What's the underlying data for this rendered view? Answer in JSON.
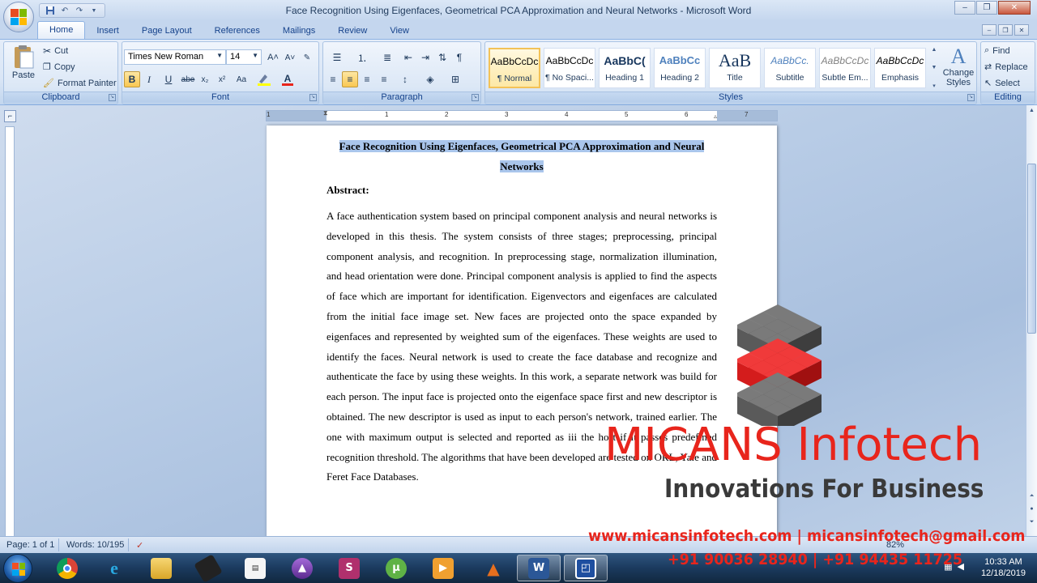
{
  "window": {
    "title": "Face Recognition Using Eigenfaces, Geometrical PCA Approximation and Neural Networks - Microsoft Word",
    "minimize": "‒",
    "restore": "❐",
    "close": "✕"
  },
  "tabs": [
    {
      "label": "Home",
      "active": true
    },
    {
      "label": "Insert"
    },
    {
      "label": "Page Layout"
    },
    {
      "label": "References"
    },
    {
      "label": "Mailings"
    },
    {
      "label": "Review"
    },
    {
      "label": "View"
    }
  ],
  "clipboard": {
    "paste": "Paste",
    "cut": "Cut",
    "copy": "Copy",
    "format_painter": "Format Painter",
    "label": "Clipboard"
  },
  "font": {
    "name": "Times New Roman",
    "size": "14",
    "label": "Font",
    "grow": "A˄",
    "shrink": "A˅",
    "bold": "B",
    "italic": "I",
    "underline": "U",
    "strike": "abe",
    "subscript": "x₂",
    "superscript": "x²",
    "change_case": "Aa",
    "font_color": "A"
  },
  "paragraph": {
    "label": "Paragraph",
    "pilcrow": "¶"
  },
  "styles": {
    "label": "Styles",
    "items": [
      {
        "sample": "AaBbCcDc",
        "name": "¶ Normal",
        "selected": true
      },
      {
        "sample": "AaBbCcDc",
        "name": "¶ No Spaci..."
      },
      {
        "sample": "AaBbC(",
        "name": "Heading 1"
      },
      {
        "sample": "AaBbCc",
        "name": "Heading 2"
      },
      {
        "sample": "AaB",
        "name": "Title"
      },
      {
        "sample": "AaBbCc.",
        "name": "Subtitle"
      },
      {
        "sample": "AaBbCcDc",
        "name": "Subtle Em..."
      },
      {
        "sample": "AaBbCcDc",
        "name": "Emphasis"
      }
    ],
    "change_styles": "Change Styles"
  },
  "editing": {
    "label": "Editing",
    "find": "Find",
    "replace": "Replace",
    "select": "Select"
  },
  "ruler": {
    "numbers": [
      "1",
      "1",
      "2",
      "3",
      "4",
      "5",
      "6",
      "7"
    ]
  },
  "document": {
    "title": "Face Recognition Using Eigenfaces, Geometrical PCA Approximation and Neural Networks",
    "abstract_heading": "Abstract:",
    "abstract_body": "A face authentication system based on principal component analysis and neural networks is developed in this thesis. The system consists of three stages; preprocessing, principal component analysis, and recognition. In preprocessing stage, normalization illumination, and head orientation were done. Principal component analysis is applied to find the aspects of face which are important for identification. Eigenvectors and eigenfaces are calculated from the initial face image set. New faces are projected onto the space expanded by eigenfaces and represented by weighted sum of the eigenfaces. These weights are used to identify the faces. Neural network is used to create the face database and recognize and authenticate the face by using these weights. In this work, a separate network was build for each person. The input face is projected onto the eigenface space first and new descriptor is obtained. The new descriptor is used as input to each person's network, trained earlier. The one with maximum output is selected and reported as iii the host if it passes predefined recognition threshold. The algorithms that have been developed are tested on ORL, Yale and Feret Face Databases."
  },
  "status": {
    "page": "Page: 1 of 1",
    "words": "Words: 10/195",
    "zoom": "82%"
  },
  "taskbar": {
    "time": "10:33 AM",
    "date": "12/18/2019"
  },
  "watermark": {
    "brand": "MICANS Infotech",
    "slogan": "Innovations For Business",
    "contact": "www.micansinfotech.com | micansinfotech@gmail.com",
    "phone": "+91 90036 28940 | +91 94435 11725"
  },
  "colors": {
    "accent": "#15428b",
    "brand_red": "#e8251c",
    "selection": "#aac6ec"
  }
}
